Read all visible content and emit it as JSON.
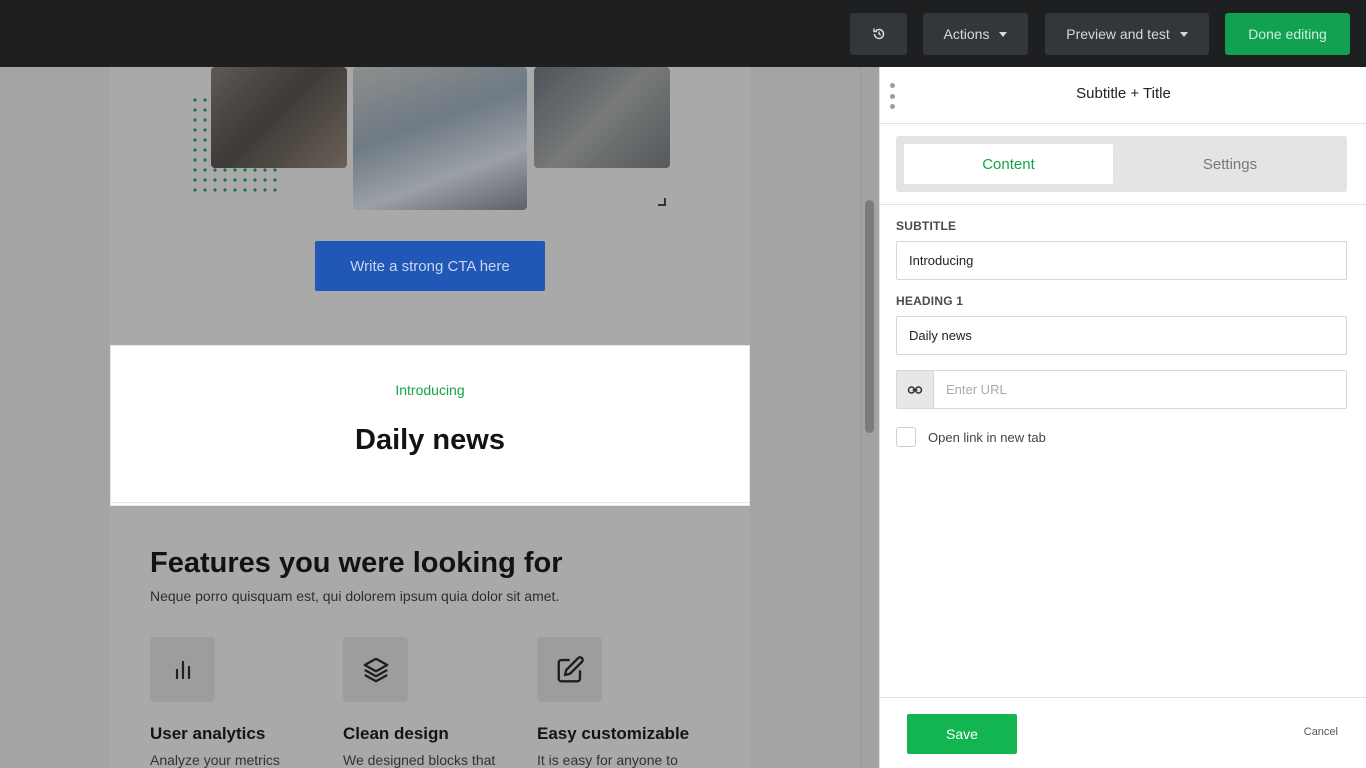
{
  "topbar": {
    "history_icon": "history-icon",
    "actions_label": "Actions",
    "preview_label": "Preview and test",
    "done_label": "Done editing",
    "done_color": "#12a150"
  },
  "email": {
    "cta_label": "Write a strong CTA here",
    "cta_color": "#2158b8",
    "selected_block": {
      "subtitle": "Introducing",
      "heading": "Daily news"
    },
    "features": {
      "title": "Features you were looking for",
      "subtitle": "Neque porro quisquam est, qui dolorem ipsum quia dolor sit amet.",
      "items": [
        {
          "icon": "bar-chart-icon",
          "title": "User analytics",
          "text": "Analyze your metrics"
        },
        {
          "icon": "layers-icon",
          "title": "Clean design",
          "text": "We designed blocks that"
        },
        {
          "icon": "edit-icon",
          "title": "Easy customizable",
          "text": "It is easy for anyone to"
        }
      ]
    }
  },
  "panel": {
    "title": "Subtitle + Title",
    "tabs": [
      {
        "label": "Content",
        "active": true
      },
      {
        "label": "Settings",
        "active": false
      }
    ],
    "subtitle_label": "SUBTITLE",
    "subtitle_value": "Introducing",
    "heading_label": "HEADING 1",
    "heading_value": "Daily news",
    "url_placeholder": "Enter URL",
    "url_icon": "link-icon",
    "new_tab_label": "Open link in new tab",
    "new_tab_checked": false,
    "save_label": "Save",
    "cancel_label": "Cancel",
    "accent_color": "#15a34a"
  }
}
